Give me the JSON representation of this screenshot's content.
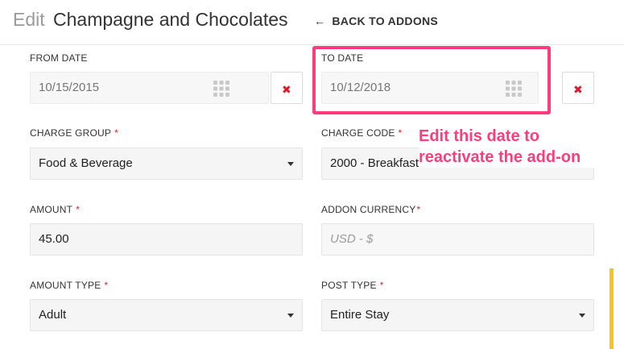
{
  "header": {
    "title_prefix": "Edit",
    "title": "Champagne and Chocolates",
    "back_label": "BACK TO ADDONS"
  },
  "form": {
    "from_date": {
      "label": "FROM DATE",
      "value": "10/15/2015"
    },
    "to_date": {
      "label": "TO DATE",
      "value": "10/12/2018"
    },
    "charge_group": {
      "label": "CHARGE GROUP",
      "required": "*",
      "value": "Food & Beverage"
    },
    "charge_code": {
      "label": "CHARGE CODE",
      "required": "*",
      "value": "2000 - Breakfast"
    },
    "amount": {
      "label": "AMOUNT",
      "required": "*",
      "value": "45.00"
    },
    "addon_currency": {
      "label": "ADDON CURRENCY",
      "required": "*",
      "placeholder": "USD - $"
    },
    "amount_type": {
      "label": "AMOUNT TYPE",
      "required": "*",
      "value": "Adult"
    },
    "post_type": {
      "label": "POST TYPE",
      "required": "*",
      "value": "Entire Stay"
    }
  },
  "annotation": {
    "text": "Edit this date to reactivate the add-on"
  },
  "colors": {
    "accent": "#ff3b7f",
    "required": "#e0192a",
    "scroll_accent": "#f5c518"
  },
  "icons": {
    "back": "arrow-left-icon",
    "calendar": "calendar-grid-icon",
    "clear": "close-x-icon",
    "dropdown": "caret-down-icon"
  }
}
